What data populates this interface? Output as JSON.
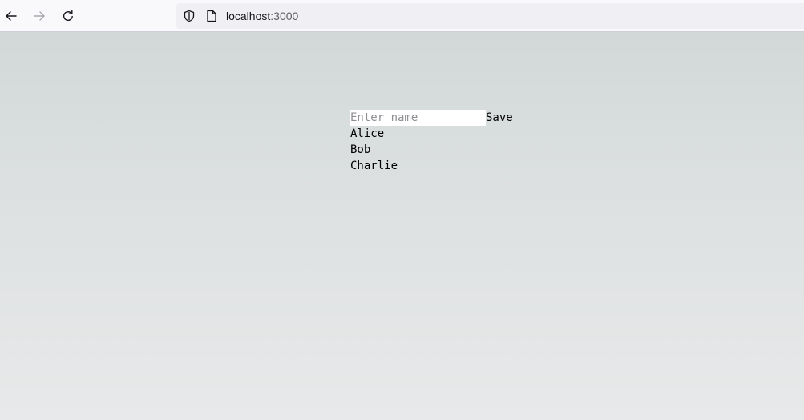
{
  "browser": {
    "url_host": "localhost",
    "url_port": ":3000"
  },
  "form": {
    "name_placeholder": "Enter name",
    "name_value": "",
    "save_label": "Save"
  },
  "names": [
    "Alice",
    "Bob",
    "Charlie"
  ],
  "icons": {
    "back": "back-arrow-icon",
    "forward": "forward-arrow-icon",
    "reload": "reload-icon",
    "shield": "shield-icon",
    "page": "page-icon"
  },
  "colors": {
    "chrome_bg": "#f9f9fb",
    "urlbar_bg": "#f0f0f4",
    "page_bg_top": "#d2d8d8",
    "page_bg_bottom": "#e8e9ea"
  }
}
